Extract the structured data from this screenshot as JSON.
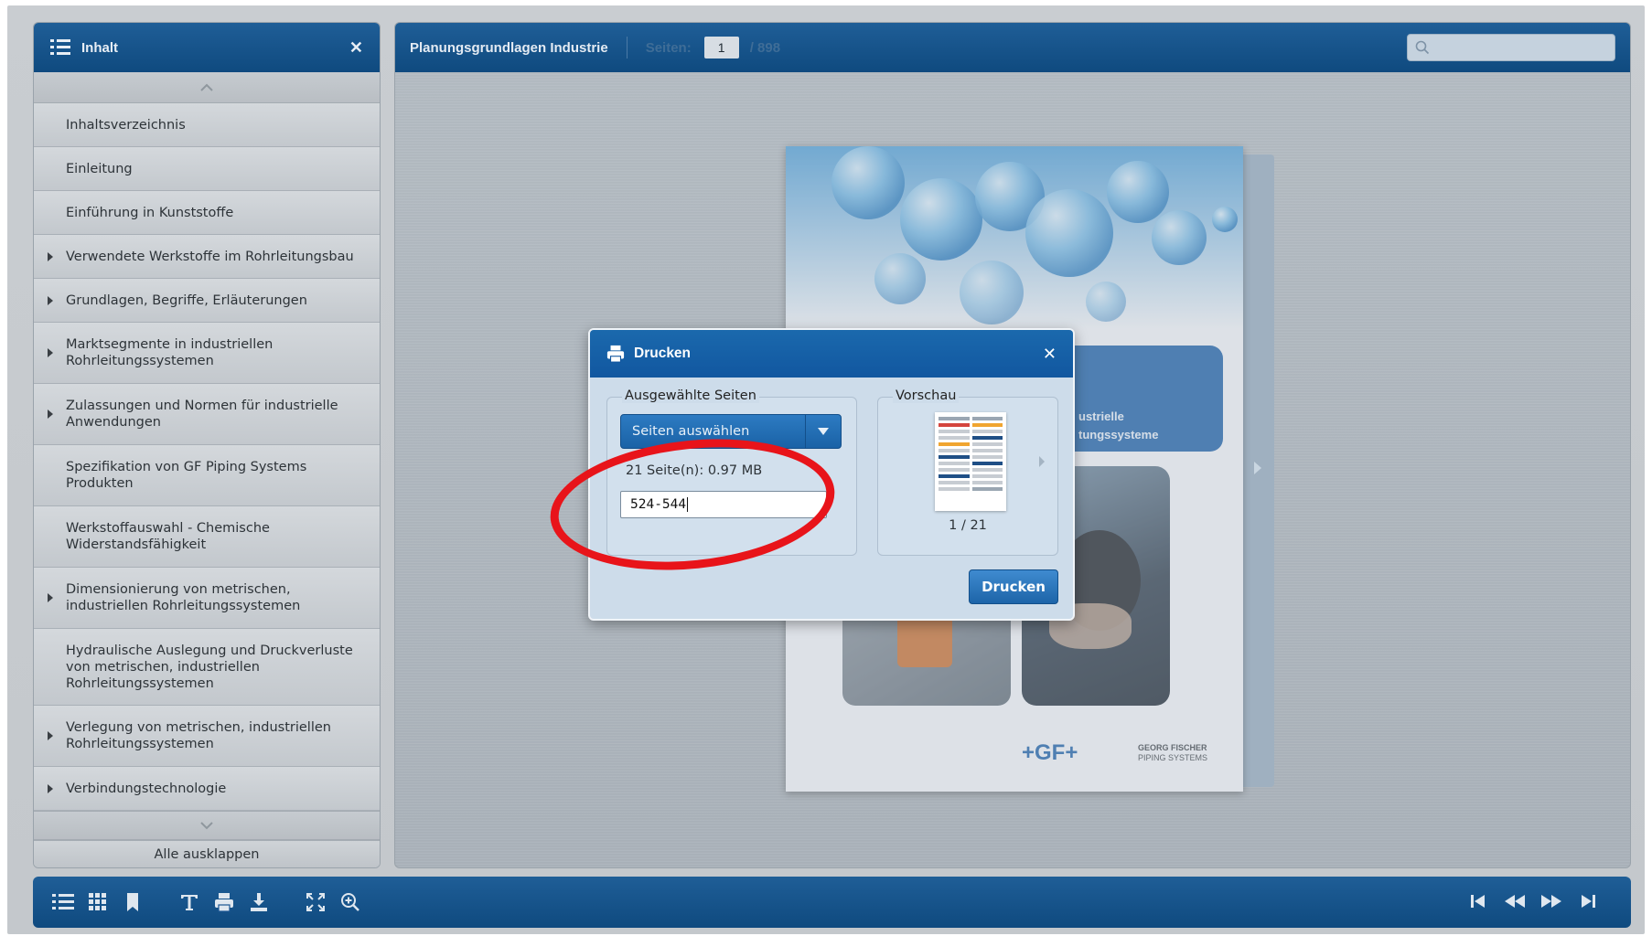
{
  "sidebar": {
    "title": "Inhalt",
    "items": [
      {
        "label": "Inhaltsverzeichnis",
        "expandable": false
      },
      {
        "label": "Einleitung",
        "expandable": false
      },
      {
        "label": "Einführung in Kunststoffe",
        "expandable": false
      },
      {
        "label": "Verwendete Werkstoffe im Rohrleitungsbau",
        "expandable": true
      },
      {
        "label": "Grundlagen, Begriffe, Erläuterungen",
        "expandable": true
      },
      {
        "label": "Marktsegmente in industriellen Rohrleitungssystemen",
        "expandable": true
      },
      {
        "label": "Zulassungen und Normen für industrielle Anwendungen",
        "expandable": true
      },
      {
        "label": "Spezifikation von GF Piping Systems Produkten",
        "expandable": false
      },
      {
        "label": "Werkstoffauswahl - Chemische Widerstandsfähigkeit",
        "expandable": false
      },
      {
        "label": "Dimensionierung von metrischen, industriellen Rohrleitungssystemen",
        "expandable": true
      },
      {
        "label": "Hydraulische Auslegung und Druckverluste von metrischen, industriellen Rohrleitungssystemen",
        "expandable": false
      },
      {
        "label": "Verlegung von metrischen, industriellen Rohrleitungssystemen",
        "expandable": true
      },
      {
        "label": "Verbindungstechnologie",
        "expandable": true
      }
    ],
    "expand_all_label": "Alle ausklappen"
  },
  "viewer": {
    "doc_title": "Planungsgrundlagen Industrie",
    "pages_label": "Seiten:",
    "current_page": "1",
    "total_pages": "/ 898"
  },
  "cover": {
    "title_line1": "ustrielle",
    "title_line2": "tungssysteme",
    "brand_logo": "+GF+",
    "brand_name_line1": "GEORG FISCHER",
    "brand_name_line2": "PIPING SYSTEMS"
  },
  "dialog": {
    "title": "Drucken",
    "selected_pages_legend": "Ausgewählte Seiten",
    "select_label": "Seiten auswählen",
    "size_info": "21 Seite(n): 0.97 MB",
    "range_value": "524-544",
    "preview_legend": "Vorschau",
    "preview_counter": "1 / 21",
    "print_button": "Drucken"
  },
  "colors": {
    "header_blue": "#0f4a7f",
    "dialog_blue": "#1b69ad",
    "annotation_red": "#e8141a",
    "brand_blue": "#1a5fa6"
  }
}
